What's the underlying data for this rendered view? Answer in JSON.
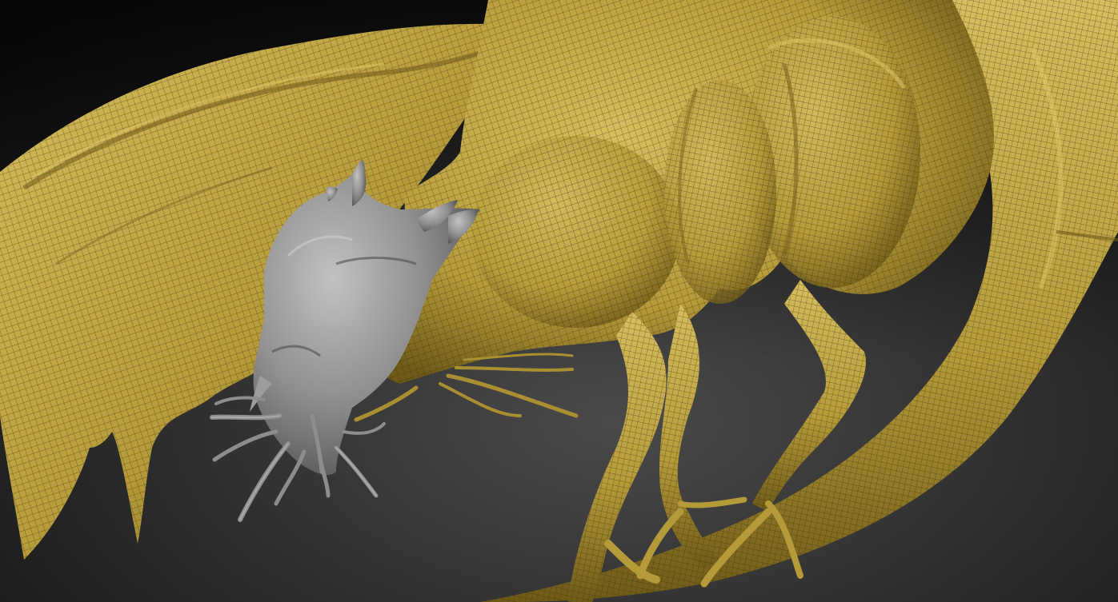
{
  "viewport": {
    "subject": "sculpt-viewport",
    "colors": {
      "background_top": "#0c0c0c",
      "background_bottom": "#4a4a4a",
      "mesh_fill": "#b59a3a",
      "mesh_highlight": "#d6bd5e",
      "mesh_shadow": "#6e5a18",
      "wire": "#3c3208",
      "head_fill": "#8d8d8d",
      "head_highlight": "#c2c2c2",
      "head_shadow": "#4e4e4e"
    }
  }
}
